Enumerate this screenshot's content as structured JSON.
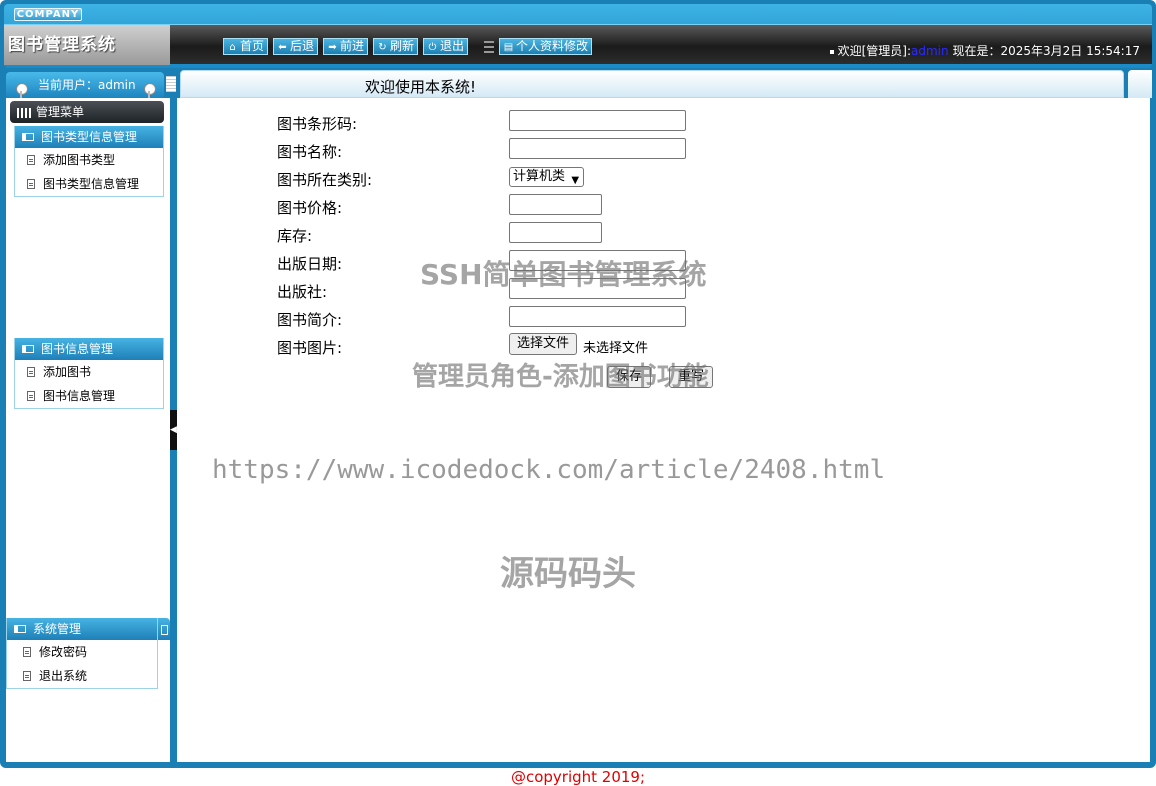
{
  "header": {
    "company": "COMPANY",
    "system_title": "图书管理系统",
    "nav": [
      {
        "label": "首页",
        "icon": "home-icon",
        "glyph": "⌂"
      },
      {
        "label": "后退",
        "icon": "back-icon",
        "glyph": "⬅"
      },
      {
        "label": "前进",
        "icon": "forward-icon",
        "glyph": "➡"
      },
      {
        "label": "刷新",
        "icon": "refresh-icon",
        "glyph": "↻"
      },
      {
        "label": "退出",
        "icon": "power-icon",
        "glyph": "⏻"
      },
      {
        "label": "个人资料修改",
        "icon": "profile-icon",
        "glyph": "▤"
      }
    ],
    "welcome_prefix": "欢迎[管理员]:",
    "username": "admin",
    "now_label": "现在是：",
    "datetime": "2025年3月2日 15:54:17"
  },
  "userbar": {
    "current_user": "当前用户：admin",
    "welcome_message": "欢迎使用本系统!"
  },
  "sidebar": {
    "menu_title": "管理菜单",
    "groups": [
      {
        "title": "图书类型信息管理",
        "items": [
          "添加图书类型",
          "图书类型信息管理"
        ]
      },
      {
        "title": "图书信息管理",
        "items": [
          "添加图书",
          "图书信息管理"
        ]
      },
      {
        "title": "系统管理",
        "items": [
          "修改密码",
          "退出系统"
        ]
      }
    ]
  },
  "form": {
    "fields": {
      "barcode": {
        "label": "图书条形码:",
        "value": ""
      },
      "name": {
        "label": "图书名称:",
        "value": ""
      },
      "category": {
        "label": "图书所在类别:",
        "selected": "计算机类"
      },
      "price": {
        "label": "图书价格:",
        "value": ""
      },
      "stock": {
        "label": "库存:",
        "value": ""
      },
      "publish_date": {
        "label": "出版日期:",
        "value": ""
      },
      "publisher": {
        "label": "出版社:",
        "value": ""
      },
      "intro": {
        "label": "图书简介:",
        "value": ""
      },
      "image": {
        "label": "图书图片:",
        "button": "选择文件",
        "status": "未选择文件"
      }
    },
    "save_label": "保存",
    "reset_label": "重写"
  },
  "watermark": {
    "line1": "SSH简单图书管理系统",
    "line2": "管理员角色-添加图书功能",
    "line3": "https://www.icodedock.com/article/2408.html",
    "line4": "源码码头"
  },
  "footer": {
    "copyright": "@copyright 2019;"
  },
  "colors": {
    "frame_blue": "#1a7fb5",
    "accent_blue": "#2e9bd0",
    "footer_red": "#e00000"
  }
}
